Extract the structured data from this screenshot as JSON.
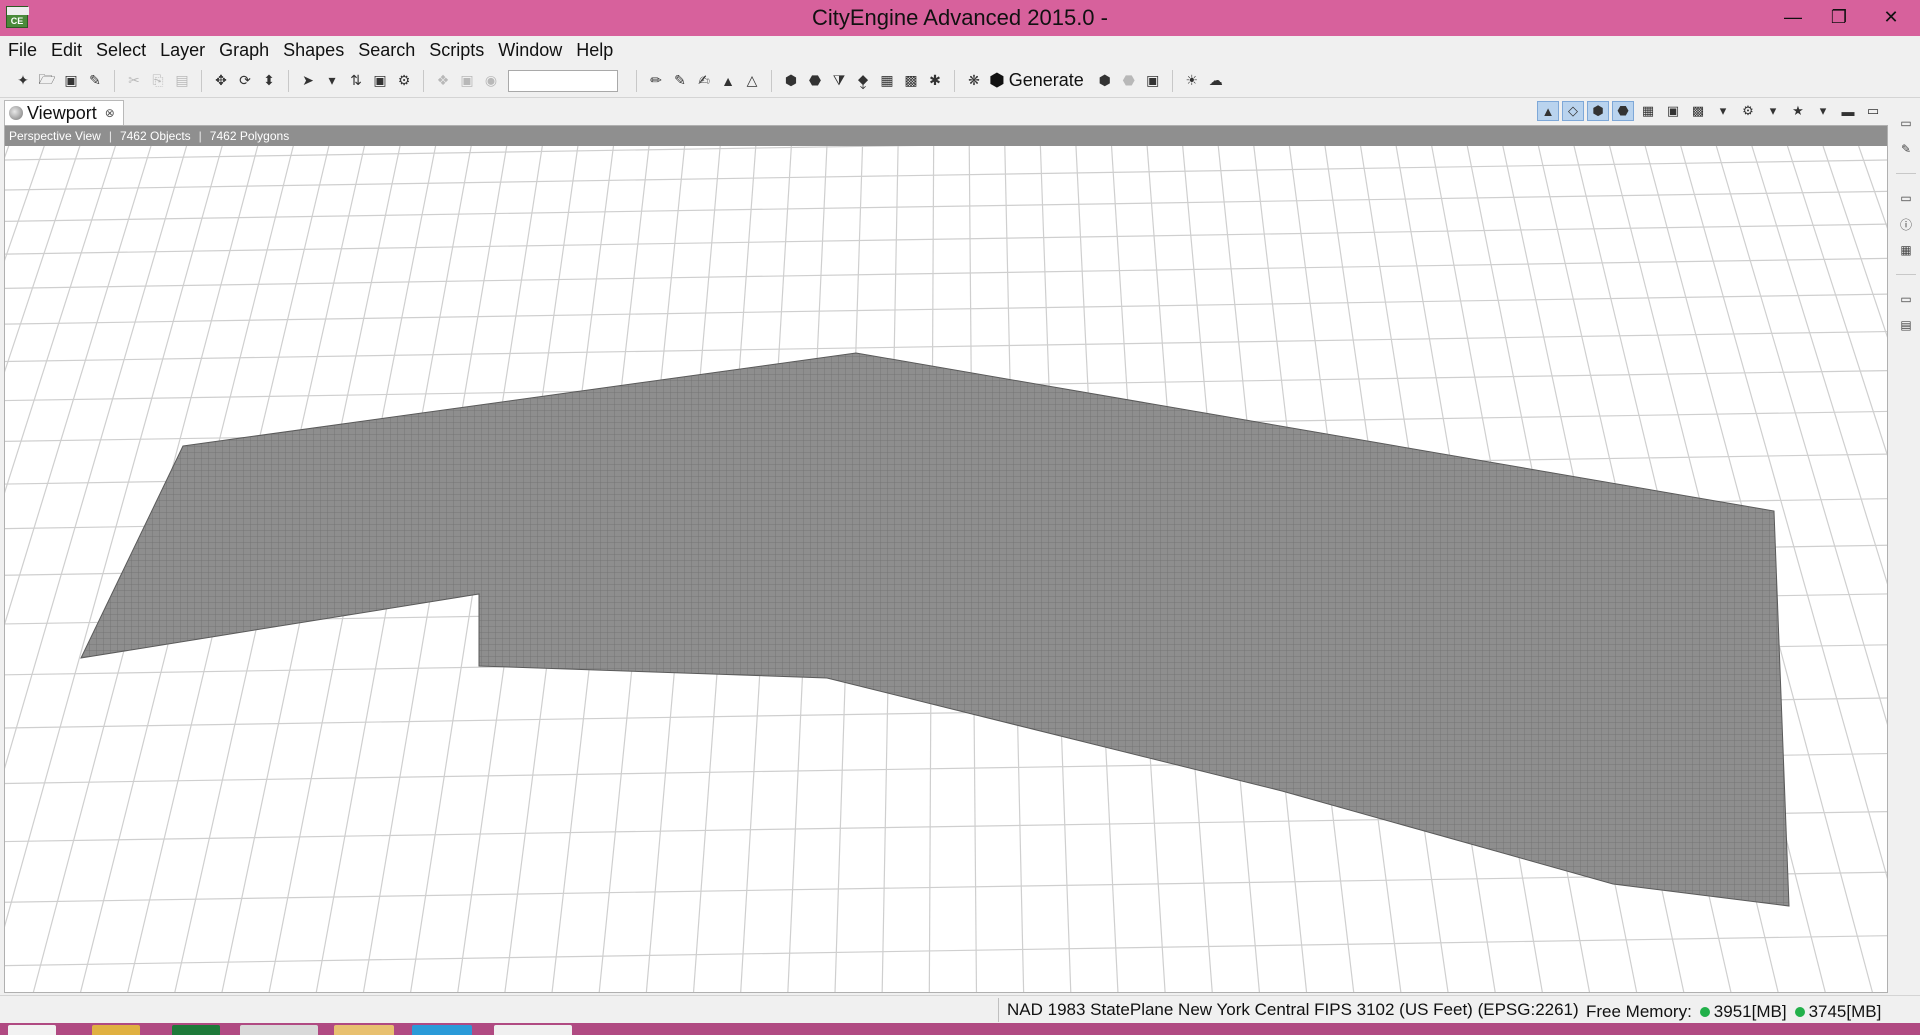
{
  "window": {
    "title": "CityEngine Advanced 2015.0 -",
    "app_icon_text": "CE",
    "minimize": "—",
    "maximize": "❐",
    "close": "✕"
  },
  "menu": [
    "File",
    "Edit",
    "Select",
    "Layer",
    "Graph",
    "Shapes",
    "Search",
    "Scripts",
    "Window",
    "Help"
  ],
  "toolbar": {
    "search_value": "",
    "generate_label": "Generate"
  },
  "viewport": {
    "tab_label": "Viewport",
    "view_mode": "Perspective View",
    "objects": "7462 Objects",
    "polygons": "7462 Polygons"
  },
  "status": {
    "crs": "NAD 1983 StatePlane New York Central FIPS 3102 (US Feet) (EPSG:2261)",
    "memory_label": "Free Memory:",
    "memory_1": "3951[MB]",
    "memory_2": "3745[MB]"
  },
  "colors": {
    "titlebar": "#d7619c",
    "shape_fill": "#8e8e8e",
    "shape_line": "#6f6f6f",
    "grid_line": "#cfcfcf",
    "memory_ok": "#22b04a"
  }
}
